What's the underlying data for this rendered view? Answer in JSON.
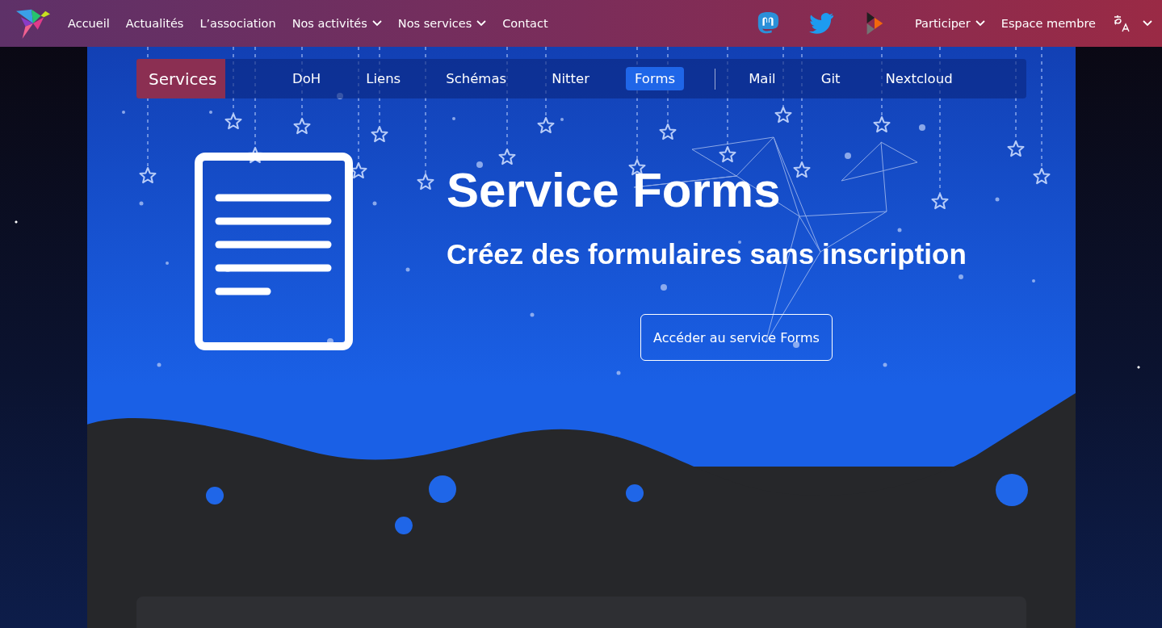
{
  "top_nav": {
    "left": [
      {
        "label": "Accueil",
        "dropdown": false
      },
      {
        "label": "Actualités",
        "dropdown": false
      },
      {
        "label": "L’association",
        "dropdown": false
      },
      {
        "label": "Nos activités",
        "dropdown": true
      },
      {
        "label": "Nos services",
        "dropdown": true
      },
      {
        "label": "Contact",
        "dropdown": false
      }
    ],
    "social": [
      {
        "kind": "mastodon"
      },
      {
        "kind": "twitter"
      },
      {
        "kind": "peertube"
      }
    ],
    "right": [
      {
        "label": "Participer",
        "dropdown": true
      },
      {
        "label": "Espace membre",
        "dropdown": false
      }
    ]
  },
  "services_nav": {
    "title": "Services",
    "groups": [
      [
        {
          "label": "DoH",
          "selected": false
        },
        {
          "label": "Liens",
          "selected": false
        },
        {
          "label": "Schémas",
          "selected": false
        },
        {
          "label": "Nitter",
          "selected": false
        },
        {
          "label": "Forms",
          "selected": true
        }
      ],
      [
        {
          "label": "Mail",
          "selected": false
        },
        {
          "label": "Git",
          "selected": false
        },
        {
          "label": "Nextcloud",
          "selected": false
        }
      ]
    ]
  },
  "hero": {
    "title": "Service Forms",
    "subtitle": "Créez des formulaires sans inscription",
    "button": "Accéder au service Forms"
  }
}
